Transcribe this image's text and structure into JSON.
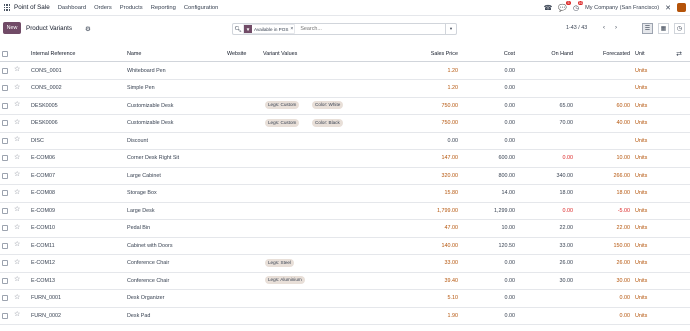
{
  "navbar": {
    "brand": "Point of Sale",
    "menu": [
      "Dashboard",
      "Orders",
      "Products",
      "Reporting",
      "Configuration"
    ],
    "messages_badge": "5",
    "activity_badge": "16",
    "company": "My Company (San Francisco)"
  },
  "control": {
    "new_label": "New",
    "title": "Product Variants",
    "facet": "Available in POS",
    "search_placeholder": "Search...",
    "pager": "1-43 / 43"
  },
  "columns": {
    "ref": "Internal Reference",
    "name": "Name",
    "website": "Website",
    "variant": "Variant Values",
    "price": "Sales Price",
    "cost": "Cost",
    "onhand": "On Hand",
    "forecast": "Forecasted",
    "unit": "Unit"
  },
  "rows": [
    {
      "ref": "CONS_0001",
      "name": "Whiteboard Pen",
      "tags": [],
      "price": "1.20",
      "cost": "0.00",
      "onhand": "",
      "forecast": "",
      "price_color": "orange",
      "onhand_color": "",
      "forecast_color": "",
      "unit": "Units"
    },
    {
      "ref": "CONS_0002",
      "name": "Simple Pen",
      "tags": [],
      "price": "1.20",
      "cost": "0.00",
      "onhand": "",
      "forecast": "",
      "price_color": "orange",
      "onhand_color": "",
      "forecast_color": "",
      "unit": "Units"
    },
    {
      "ref": "DESK0005",
      "name": "Customizable Desk",
      "tags": [
        "Legs: Custom",
        "Color: White"
      ],
      "price": "750.00",
      "cost": "0.00",
      "onhand": "65.00",
      "forecast": "60.00",
      "price_color": "orange",
      "onhand_color": "",
      "forecast_color": "orange",
      "unit": "Units"
    },
    {
      "ref": "DESK0006",
      "name": "Customizable Desk",
      "tags": [
        "Legs: Custom",
        "Color: Black"
      ],
      "price": "750.00",
      "cost": "0.00",
      "onhand": "70.00",
      "forecast": "40.00",
      "price_color": "orange",
      "onhand_color": "",
      "forecast_color": "orange",
      "unit": "Units"
    },
    {
      "ref": "DISC",
      "name": "Discount",
      "tags": [],
      "price": "0.00",
      "cost": "0.00",
      "onhand": "",
      "forecast": "",
      "price_color": "",
      "onhand_color": "",
      "forecast_color": "",
      "unit": "Units"
    },
    {
      "ref": "E-COM06",
      "name": "Corner Desk Right Sit",
      "tags": [],
      "price": "147.00",
      "cost": "600.00",
      "onhand": "0.00",
      "forecast": "10.00",
      "price_color": "orange",
      "onhand_color": "red",
      "forecast_color": "orange",
      "unit": "Units"
    },
    {
      "ref": "E-COM07",
      "name": "Large Cabinet",
      "tags": [],
      "price": "320.00",
      "cost": "800.00",
      "onhand": "340.00",
      "forecast": "266.00",
      "price_color": "orange",
      "onhand_color": "",
      "forecast_color": "orange",
      "unit": "Units"
    },
    {
      "ref": "E-COM08",
      "name": "Storage Box",
      "tags": [],
      "price": "15.80",
      "cost": "14.00",
      "onhand": "18.00",
      "forecast": "18.00",
      "price_color": "orange",
      "onhand_color": "",
      "forecast_color": "orange",
      "unit": "Units"
    },
    {
      "ref": "E-COM09",
      "name": "Large Desk",
      "tags": [],
      "price": "1,799.00",
      "cost": "1,299.00",
      "onhand": "0.00",
      "forecast": "-5.00",
      "price_color": "orange",
      "onhand_color": "red",
      "forecast_color": "red",
      "unit": "Units"
    },
    {
      "ref": "E-COM10",
      "name": "Pedal Bin",
      "tags": [],
      "price": "47.00",
      "cost": "10.00",
      "onhand": "22.00",
      "forecast": "22.00",
      "price_color": "orange",
      "onhand_color": "",
      "forecast_color": "orange",
      "unit": "Units"
    },
    {
      "ref": "E-COM11",
      "name": "Cabinet with Doors",
      "tags": [],
      "price": "140.00",
      "cost": "120.50",
      "onhand": "33.00",
      "forecast": "150.00",
      "price_color": "orange",
      "onhand_color": "",
      "forecast_color": "orange",
      "unit": "Units"
    },
    {
      "ref": "E-COM12",
      "name": "Conference Chair",
      "tags": [
        "Legs: Steel"
      ],
      "price": "33.00",
      "cost": "0.00",
      "onhand": "26.00",
      "forecast": "26.00",
      "price_color": "orange",
      "onhand_color": "",
      "forecast_color": "orange",
      "unit": "Units"
    },
    {
      "ref": "E-COM13",
      "name": "Conference Chair",
      "tags": [
        "Legs: Aluminium"
      ],
      "price": "39.40",
      "cost": "0.00",
      "onhand": "30.00",
      "forecast": "30.00",
      "price_color": "orange",
      "onhand_color": "",
      "forecast_color": "orange",
      "unit": "Units"
    },
    {
      "ref": "FURN_0001",
      "name": "Desk Organizer",
      "tags": [],
      "price": "5.10",
      "cost": "0.00",
      "onhand": "",
      "forecast": "0.00",
      "price_color": "orange",
      "onhand_color": "",
      "forecast_color": "orange",
      "unit": "Units"
    },
    {
      "ref": "FURN_0002",
      "name": "Desk Pad",
      "tags": [],
      "price": "1.90",
      "cost": "0.00",
      "onhand": "",
      "forecast": "0.00",
      "price_color": "orange",
      "onhand_color": "",
      "forecast_color": "orange",
      "unit": "Units"
    }
  ]
}
